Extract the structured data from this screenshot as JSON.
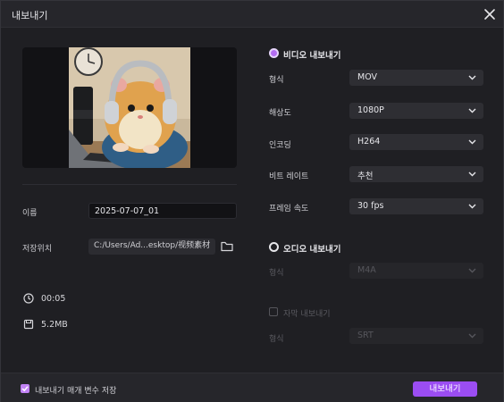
{
  "window": {
    "title": "내보내기"
  },
  "left": {
    "name_label": "이름",
    "name_value": "2025-07-07_01",
    "location_label": "저장위치",
    "location_value": "C:/Users/Ad...esktop/视频素材",
    "duration": "00:05",
    "file_size": "5.2MB"
  },
  "video": {
    "section_label": "비디오 내보내기",
    "selected": true,
    "rows": [
      {
        "label": "형식",
        "value": "MOV"
      },
      {
        "label": "해상도",
        "value": "1080P"
      },
      {
        "label": "인코딩",
        "value": "H264"
      },
      {
        "label": "비트 레이트",
        "value": "추천"
      },
      {
        "label": "프레임 속도",
        "value": "30  fps"
      }
    ]
  },
  "audio": {
    "section_label": "오디오 내보내기",
    "selected": false,
    "format_label": "형식",
    "format_value": "M4A"
  },
  "subtitle": {
    "checkbox_label": "자막 내보내기",
    "checked": false,
    "format_label": "형식",
    "format_value": "SRT"
  },
  "footer": {
    "remember_label": "내보내기 매개 변수 저장",
    "remember_checked": true,
    "export_label": "내보내기"
  },
  "colors": {
    "accent": "#9b4df2",
    "background": "#1f1f23",
    "titlebar": "#26262b",
    "select_bg": "#2e2e33"
  },
  "icons": {
    "close": "close-icon",
    "folder": "folder-icon",
    "clock": "clock-icon",
    "file": "file-size-icon",
    "chevron": "chevron-down-icon"
  }
}
